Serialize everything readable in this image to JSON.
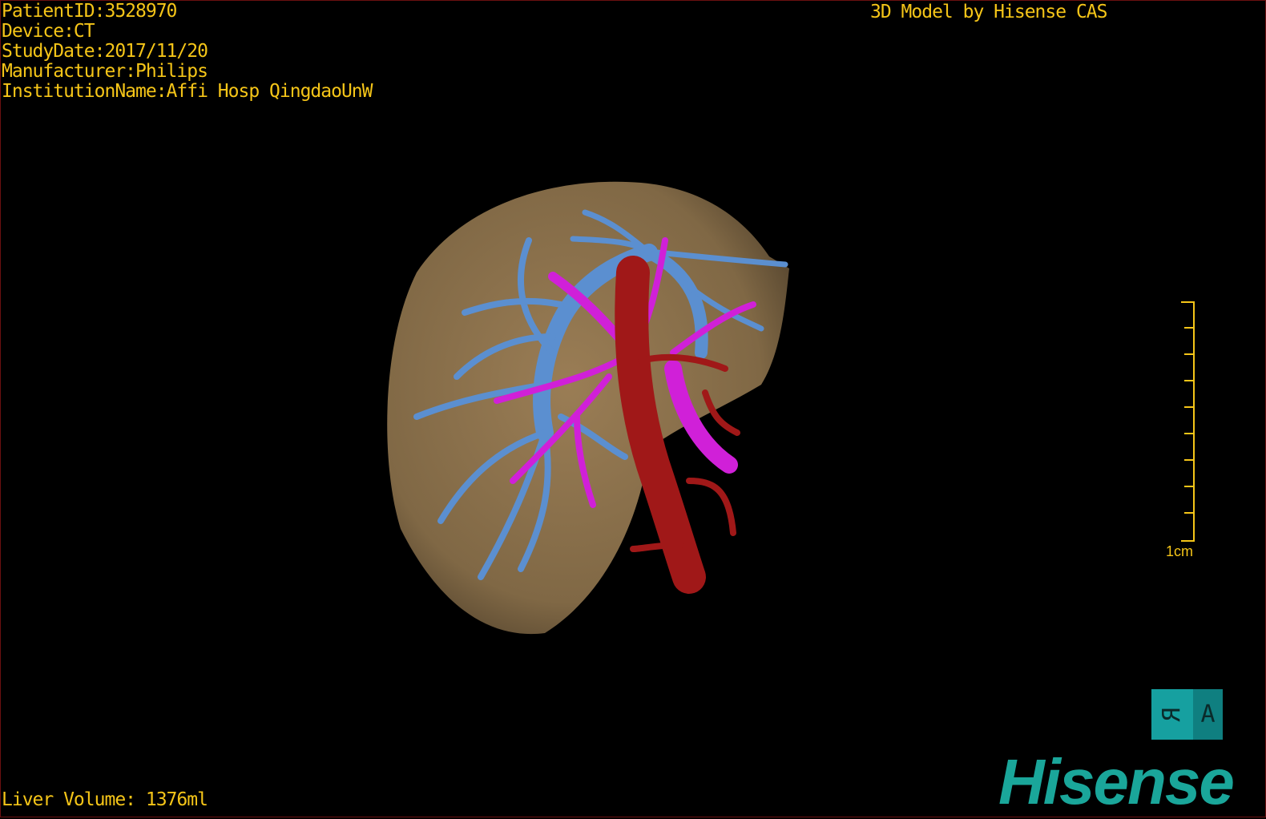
{
  "info": {
    "patient_id": "PatientID:3528970",
    "device": "Device:CT",
    "study_date": "StudyDate:2017/11/20",
    "manufacturer": "Manufacturer:Philips",
    "institution": "InstitutionName:Affi Hosp QingdaoUnW"
  },
  "credit": "3D Model by Hisense CAS",
  "liver_volume": "Liver Volume: 1376ml",
  "scale_bar": {
    "label": "1cm",
    "color": "#f5c518"
  },
  "orientation_cube": {
    "face_left": "R",
    "face_right": "A",
    "color": "#16a0a0"
  },
  "logo": "Hisense",
  "colors": {
    "text": "#f5c518",
    "liver": "#a8875a",
    "portal_vein": "#5b8fd0",
    "hepatic_vein": "#d020d8",
    "artery": "#a01818",
    "brand": "#1aa69a"
  }
}
